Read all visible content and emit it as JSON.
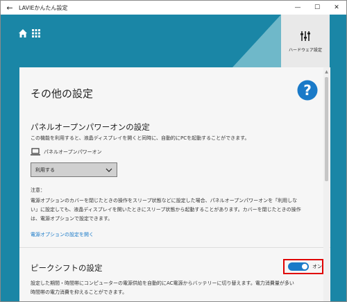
{
  "window": {
    "back_glyph": "←",
    "title": "LAVIEかんたん設定",
    "minimize_glyph": "—",
    "maximize_glyph": "☐",
    "close_glyph": "✕"
  },
  "header": {
    "home_icon": "home-icon",
    "apps_icon": "apps-grid-icon",
    "hardware_tile_label": "ハードウェア設定",
    "hardware_icon": "sliders-icon",
    "colors": {
      "background": "#1a86a6",
      "triangle": "#6fb8c9",
      "tile": "#e9e9e9"
    }
  },
  "page": {
    "title": "その他の設定",
    "help_icon": "help-icon"
  },
  "panel_open": {
    "title": "パネルオープンパワーオンの設定",
    "description": "この機能を利用すると、液晶ディスプレイを開くと同時に、自動的にPCを起動することができます。",
    "feature_label": "パネルオープンパワーオン",
    "dropdown_value": "利用する",
    "note_title": "注意：",
    "note_lines": [
      "電源オプションのカバーを閉じたときの操作をスリープ状態などに設定した場合、パネルオープンパワーオンを「利用しな",
      "い」に設定しても、液晶ディスプレイを開いたときにスリープ状態から起動することがあります。カバーを閉じたときの操作",
      "は、電源オプションで設定できます。"
    ],
    "link": "電源オプションの設定を開く"
  },
  "peak_shift": {
    "title": "ピークシフトの設定",
    "description_lines": [
      "設定した期間・時間帯にコンピューターの電源供給を自動的にAC電源からバッテリーに切り替えます。電力消費量が多い",
      "時間帯の電力消費を抑えることができます。"
    ],
    "toggle_label": "オン",
    "toggle_on": true
  }
}
